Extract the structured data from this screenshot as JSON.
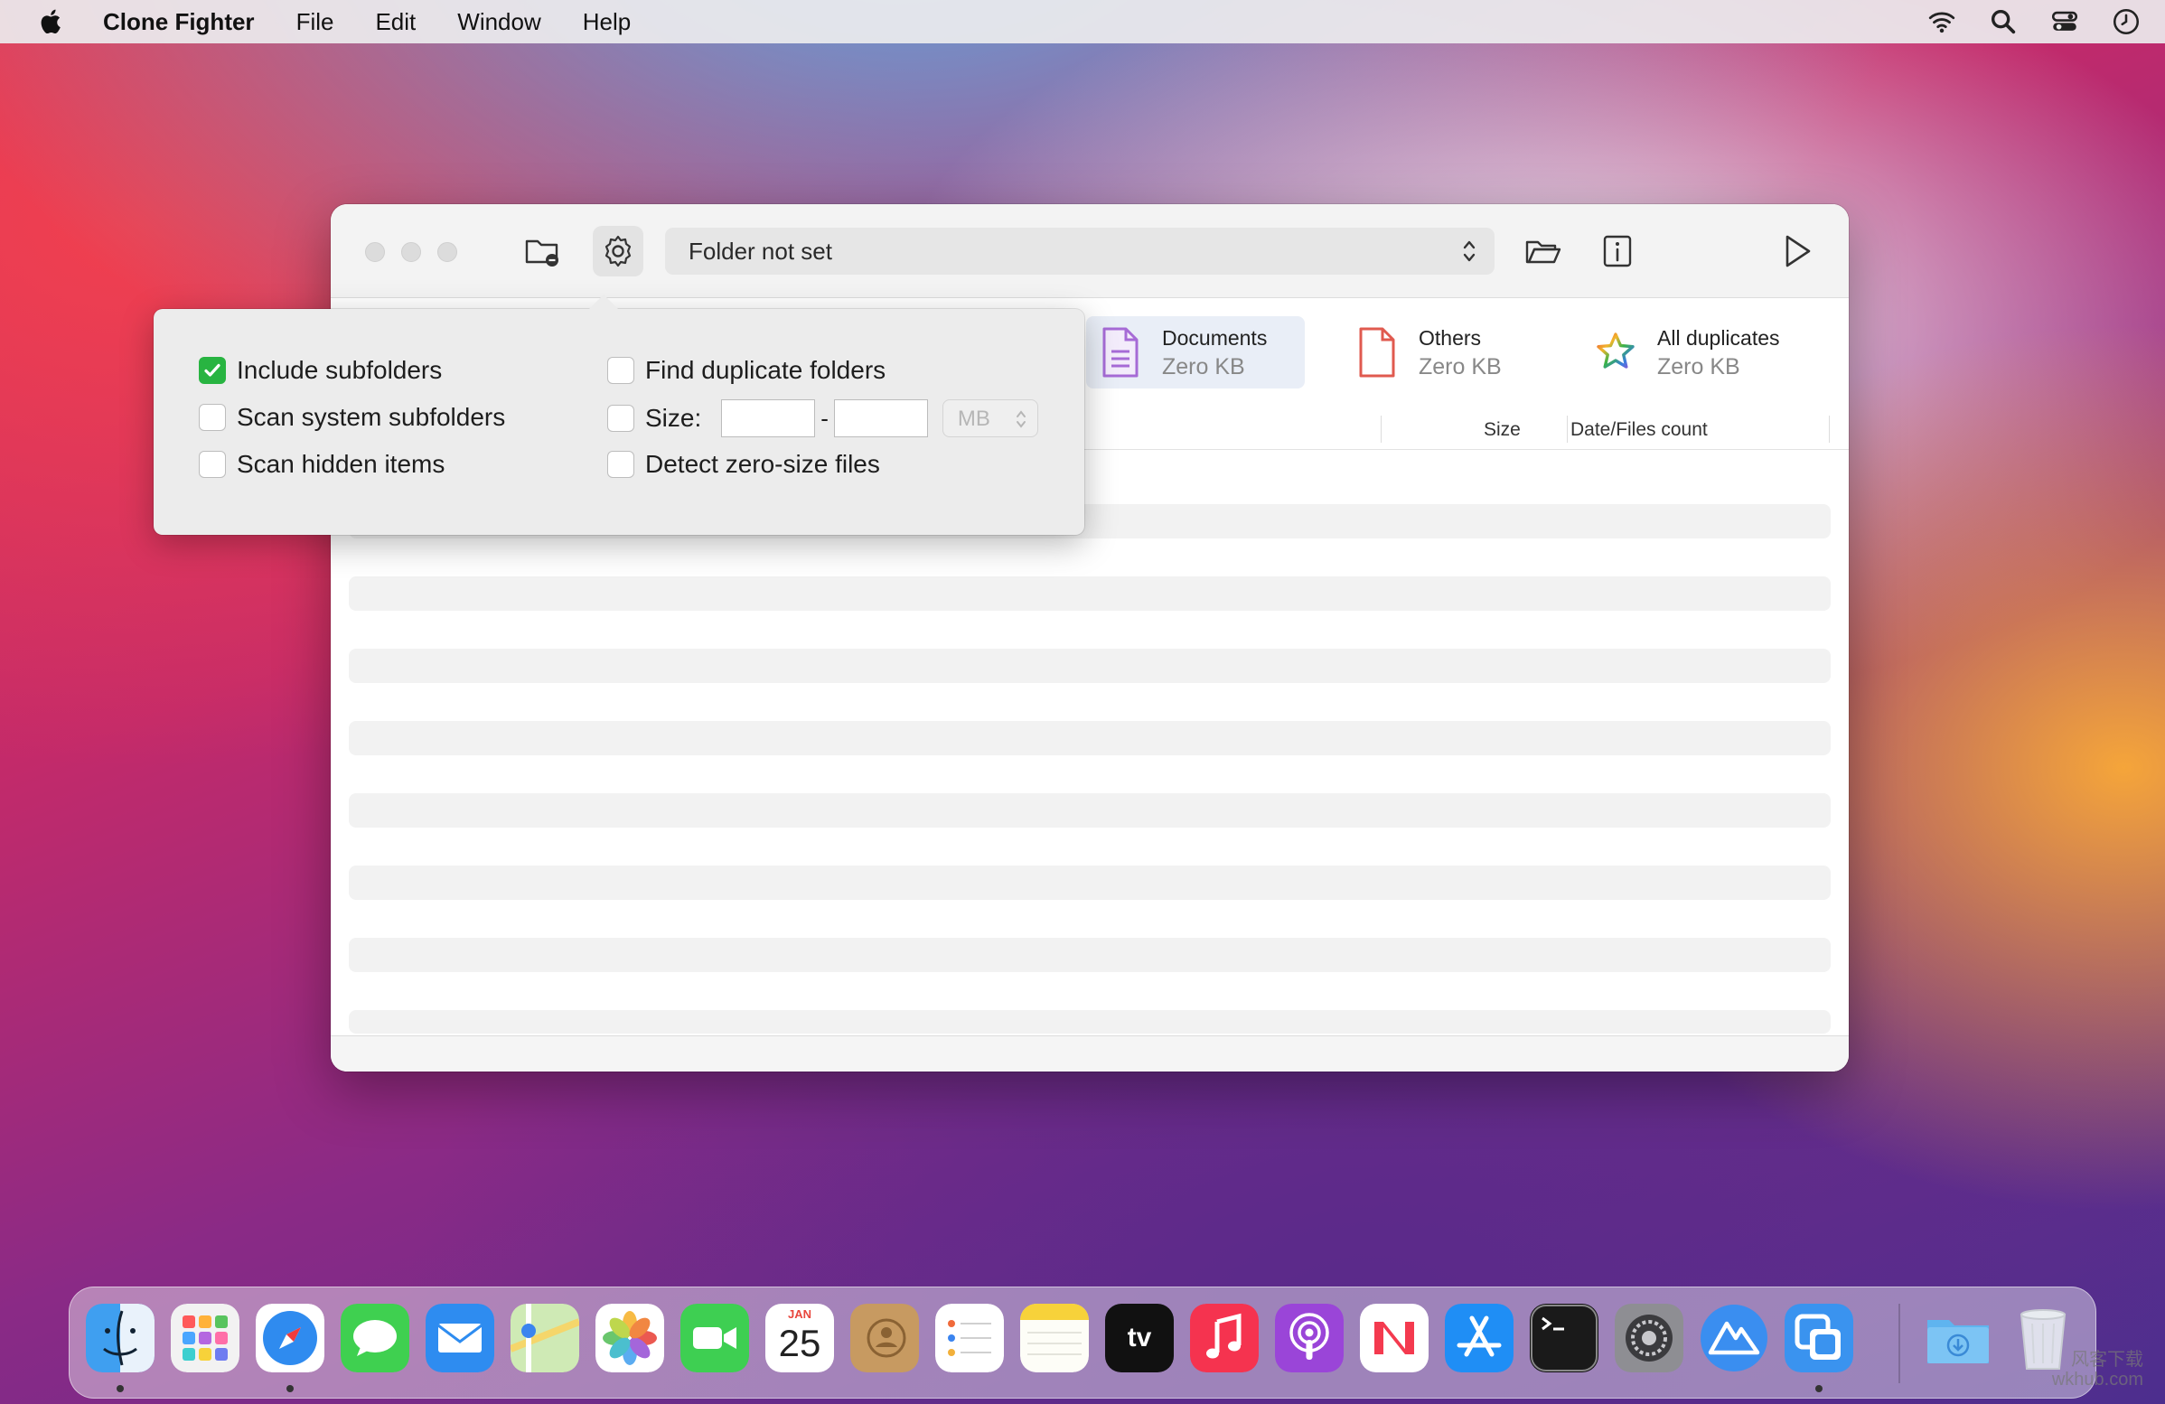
{
  "menubar": {
    "app_name": "Clone Fighter",
    "items": [
      "File",
      "Edit",
      "Window",
      "Help"
    ]
  },
  "toolbar": {
    "folder_select": "Folder not set"
  },
  "categories": [
    {
      "label": "Documents",
      "size": "Zero KB",
      "selected": true
    },
    {
      "label": "Others",
      "size": "Zero KB",
      "selected": false
    },
    {
      "label": "All duplicates",
      "size": "Zero KB",
      "selected": false
    }
  ],
  "columns": {
    "size": "Size",
    "date_files_count": "Date/Files count"
  },
  "options": {
    "include_subfolders": {
      "label": "Include subfolders",
      "checked": true
    },
    "scan_system_subfolders": {
      "label": "Scan system subfolders",
      "checked": false
    },
    "scan_hidden_items": {
      "label": "Scan hidden items",
      "checked": false
    },
    "find_duplicate_folders": {
      "label": "Find duplicate folders",
      "checked": false
    },
    "size": {
      "label": "Size:",
      "checked": false,
      "min": "",
      "max": "",
      "separator": "-",
      "unit": "MB"
    },
    "detect_zero_size": {
      "label": "Detect zero-size files",
      "checked": false
    }
  },
  "dock": {
    "calendar_month": "JAN",
    "calendar_day": "25",
    "tv_label": "tv"
  },
  "watermark": {
    "line1": "风客下载",
    "line2": "wkhub.com"
  },
  "colors": {
    "accent_check": "#28b441",
    "documents_icon": "#a66bd6",
    "others_icon": "#e05a4f"
  }
}
